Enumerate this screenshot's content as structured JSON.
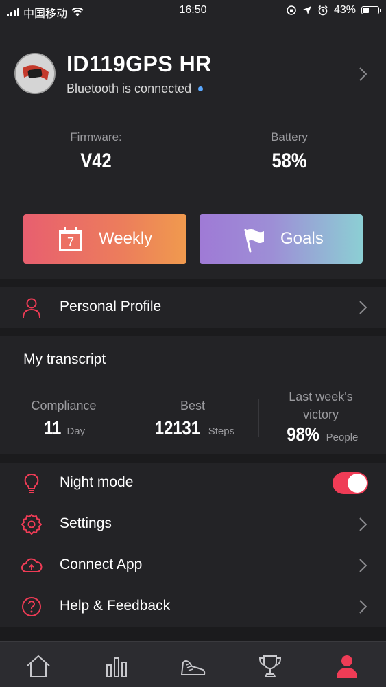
{
  "status_bar": {
    "carrier": "中国移动",
    "time": "16:50",
    "battery_percent_text": "43%",
    "battery_level": 0.43
  },
  "device": {
    "name": "ID119GPS HR",
    "bluetooth_status": "Bluetooth is connected"
  },
  "info": {
    "firmware_label": "Firmware:",
    "firmware_value": "V42",
    "battery_label": "Battery",
    "battery_value": "58%"
  },
  "buttons": {
    "weekly_label": "Weekly",
    "weekly_calendar_day": "7",
    "goals_label": "Goals"
  },
  "profile": {
    "label": "Personal Profile"
  },
  "transcript": {
    "title": "My transcript",
    "stats": [
      {
        "label": "Compliance",
        "value": "11",
        "unit": "Day"
      },
      {
        "label": "Best",
        "value": "12131",
        "unit": "Steps"
      },
      {
        "label_line1": "Last week's",
        "label_line2": "victory",
        "value": "98%",
        "unit": "People"
      }
    ]
  },
  "menu": {
    "night_mode_label": "Night mode",
    "night_mode_on": true,
    "settings_label": "Settings",
    "connect_app_label": "Connect App",
    "help_label": "Help & Feedback"
  },
  "tabs": [
    {
      "icon": "home-icon"
    },
    {
      "icon": "stats-icon"
    },
    {
      "icon": "shoe-icon"
    },
    {
      "icon": "trophy-icon"
    },
    {
      "icon": "person-icon",
      "active": true
    }
  ],
  "colors": {
    "accent": "#ef3c56",
    "background": "#232326",
    "muted_text": "#9b9b9f"
  }
}
